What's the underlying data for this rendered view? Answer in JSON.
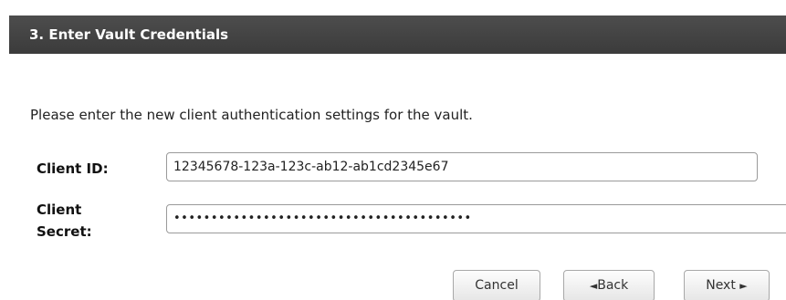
{
  "section": {
    "title": "3. Enter Vault Credentials"
  },
  "instruction": "Please enter the new client authentication settings for the vault.",
  "form": {
    "client_id_label": "Client ID:",
    "client_id_value": "12345678-123a-123c-ab12-ab1cd2345e67",
    "client_secret_label_line1": "Client",
    "client_secret_label_line2": "Secret:",
    "client_secret_value": "••••••••••••••••••••••••••••••••••••••••"
  },
  "buttons": {
    "cancel": "Cancel",
    "back_arrow": "◄",
    "back": "Back",
    "next": "Next",
    "next_arrow": "►"
  }
}
